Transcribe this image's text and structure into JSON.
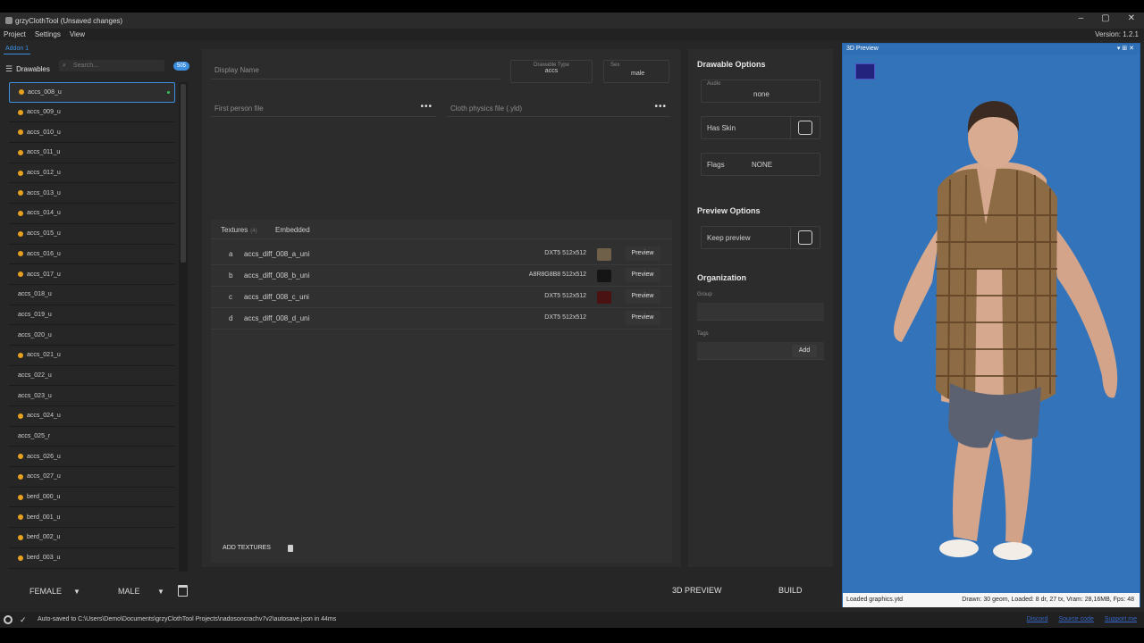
{
  "window": {
    "title": "grzyClothTool (Unsaved changes)",
    "controls": [
      "–",
      "▢",
      "✕"
    ]
  },
  "menu": {
    "items": [
      "Project",
      "Settings",
      "View"
    ],
    "version": "Version: 1.2.1"
  },
  "addon_tab": "Addon 1",
  "drawables": {
    "header": "Drawables",
    "search_placeholder": "Search...",
    "count": "505",
    "items": [
      {
        "name": "accs_008_u",
        "warn": true,
        "selected": true
      },
      {
        "name": "accs_009_u",
        "warn": true
      },
      {
        "name": "accs_010_u",
        "warn": true
      },
      {
        "name": "accs_011_u",
        "warn": true
      },
      {
        "name": "accs_012_u",
        "warn": true
      },
      {
        "name": "accs_013_u",
        "warn": true
      },
      {
        "name": "accs_014_u",
        "warn": true
      },
      {
        "name": "accs_015_u",
        "warn": true
      },
      {
        "name": "accs_016_u",
        "warn": true
      },
      {
        "name": "accs_017_u",
        "warn": true
      },
      {
        "name": "accs_018_u",
        "warn": false
      },
      {
        "name": "accs_019_u",
        "warn": false
      },
      {
        "name": "accs_020_u",
        "warn": false
      },
      {
        "name": "accs_021_u",
        "warn": true
      },
      {
        "name": "accs_022_u",
        "warn": false
      },
      {
        "name": "accs_023_u",
        "warn": false
      },
      {
        "name": "accs_024_u",
        "warn": true
      },
      {
        "name": "accs_025_r",
        "warn": false
      },
      {
        "name": "accs_026_u",
        "warn": true
      },
      {
        "name": "accs_027_u",
        "warn": true
      },
      {
        "name": "berd_000_u",
        "warn": true
      },
      {
        "name": "berd_001_u",
        "warn": true
      },
      {
        "name": "berd_002_u",
        "warn": true
      },
      {
        "name": "berd_003_u",
        "warn": true
      }
    ]
  },
  "sex_bar": {
    "female": "FEMALE",
    "male": "MALE"
  },
  "center": {
    "display_name_placeholder": "Display Name",
    "drawable_type_caption": "Drawable Type",
    "drawable_type_value": "accs",
    "sex_caption": "Sex",
    "sex_value": "male",
    "first_person_placeholder": "First person file",
    "cloth_physics_placeholder": "Cloth physics file (.yld)",
    "dots": "•••",
    "tabs": {
      "textures": "Textures",
      "textures_count": "(4)",
      "embedded": "Embedded"
    },
    "textures": [
      {
        "letter": "a",
        "name": "accs_diff_008_a_uni",
        "format": "DXT5  512x512",
        "swatch": "#6f604a",
        "preview": "Preview"
      },
      {
        "letter": "b",
        "name": "accs_diff_008_b_uni",
        "format": "A8R8G8B8  512x512",
        "swatch": "#151515",
        "preview": "Preview"
      },
      {
        "letter": "c",
        "name": "accs_diff_008_c_uni",
        "format": "DXT5  512x512",
        "swatch": "#4a1212",
        "preview": "Preview"
      },
      {
        "letter": "d",
        "name": "accs_diff_008_d_uni",
        "format": "DXT5  512x512",
        "swatch": "",
        "preview": "Preview"
      }
    ],
    "add_textures": "ADD TEXTURES"
  },
  "options": {
    "drawable_title": "Drawable Options",
    "audio_caption": "Audio",
    "audio_value": "none",
    "has_skin": "Has Skin",
    "flags_label": "Flags",
    "flags_value": "NONE",
    "preview_title": "Preview Options",
    "keep_preview": "Keep preview",
    "org_title": "Organization",
    "group_caption": "Group",
    "tags_caption": "Tags",
    "add_label": "Add"
  },
  "preview3d": {
    "title": "3D Preview",
    "head_controls": "▾ ⊞ ✕",
    "status_left": "Loaded graphics.ytd",
    "status_right": "Drawn: 30 geom, Loaded: 8 dr, 27 tx, Vram: 28,16MB, Fps: 48"
  },
  "buttons": {
    "preview_3d": "3D PREVIEW",
    "build": "BUILD"
  },
  "status": {
    "message": "Auto-saved to C:\\Users\\Demo\\Documents\\grzyClothTool Projects\\nadosoncrachv7v2\\autosave.json in 44ms",
    "links": [
      "Discord",
      "Source code",
      "Support me"
    ]
  }
}
